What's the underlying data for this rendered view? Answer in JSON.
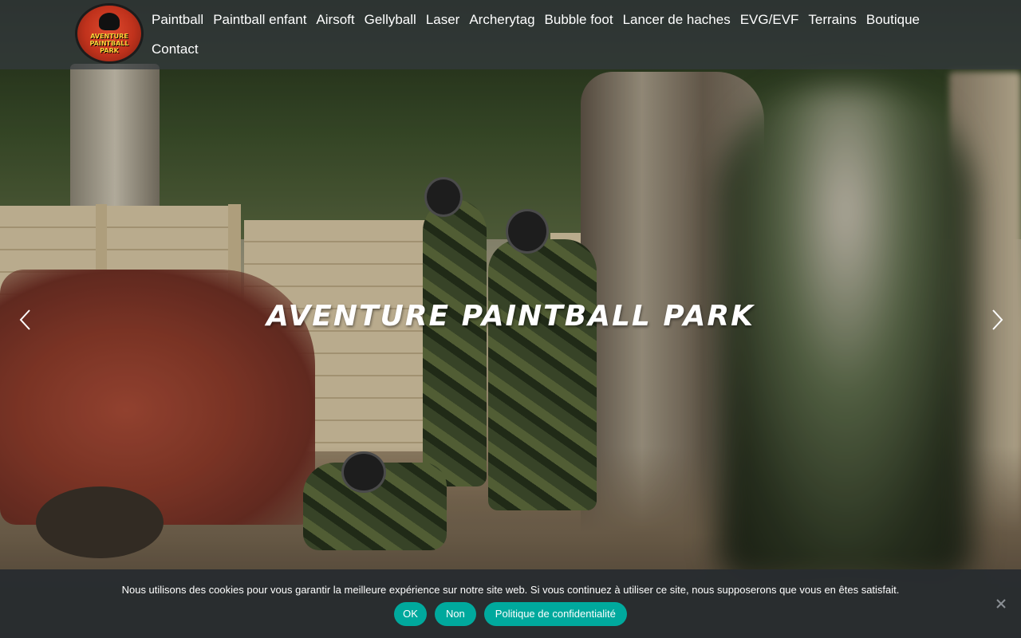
{
  "logo": {
    "line1": "AVENTURE PAINTBALL",
    "line2": "PARK"
  },
  "nav": {
    "items": [
      "Paintball",
      "Paintball enfant",
      "Airsoft",
      "Gellyball",
      "Laser",
      "Archerytag",
      "Bubble foot",
      "Lancer de haches",
      "EVG/EVF",
      "Terrains",
      "Boutique",
      "Contact"
    ]
  },
  "hero": {
    "title": "AVENTURE PAINTBALL PARK",
    "prev_icon": "chevron-left-icon",
    "next_icon": "chevron-right-icon"
  },
  "cookie": {
    "text": "Nous utilisons des cookies pour vous garantir la meilleure expérience sur notre site web. Si vous continuez à utiliser ce site, nous supposerons que vous en êtes satisfait.",
    "ok_label": "OK",
    "no_label": "Non",
    "policy_label": "Politique de confidentialité",
    "close_icon": "close-icon"
  },
  "colors": {
    "accent": "#00a99d",
    "header_bg": "#343a3e",
    "cookie_bg": "#282c30"
  }
}
